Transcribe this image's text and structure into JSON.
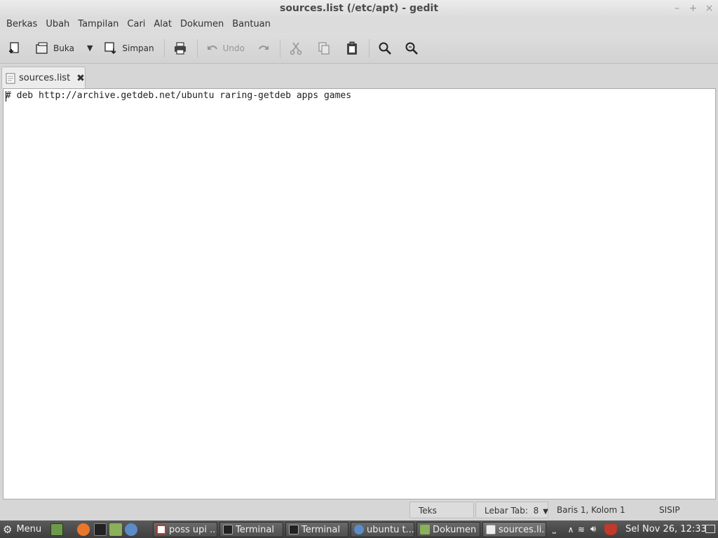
{
  "window": {
    "title": "sources.list (/etc/apt) - gedit",
    "minimize": "–",
    "maximize": "+",
    "close": "×"
  },
  "menubar": [
    "Berkas",
    "Ubah",
    "Tampilan",
    "Cari",
    "Alat",
    "Dokumen",
    "Bantuan"
  ],
  "toolbar": {
    "open_label": "Buka",
    "save_label": "Simpan",
    "undo_label": "Undo"
  },
  "tab": {
    "label": "sources.list",
    "close": "✖"
  },
  "editor": {
    "line1": "# deb http://archive.getdeb.net/ubuntu raring-getdeb apps games"
  },
  "statusbar": {
    "language": "Teks Polos",
    "tab_width": "Lebar Tab:  8",
    "position": "Baris 1, Kolom 1",
    "mode": "SISIP"
  },
  "panel": {
    "menu_label": "Menu",
    "tasks": [
      "poss upi ...",
      "Terminal",
      "Terminal",
      "ubuntu t...",
      "Dokumen",
      "sources.li..."
    ],
    "clock": "Sel Nov 26, 12:33"
  },
  "colors": {
    "panel": "#4a4a4a",
    "editor_bg": "#ffffff",
    "chrome": "#d6d6d6"
  }
}
